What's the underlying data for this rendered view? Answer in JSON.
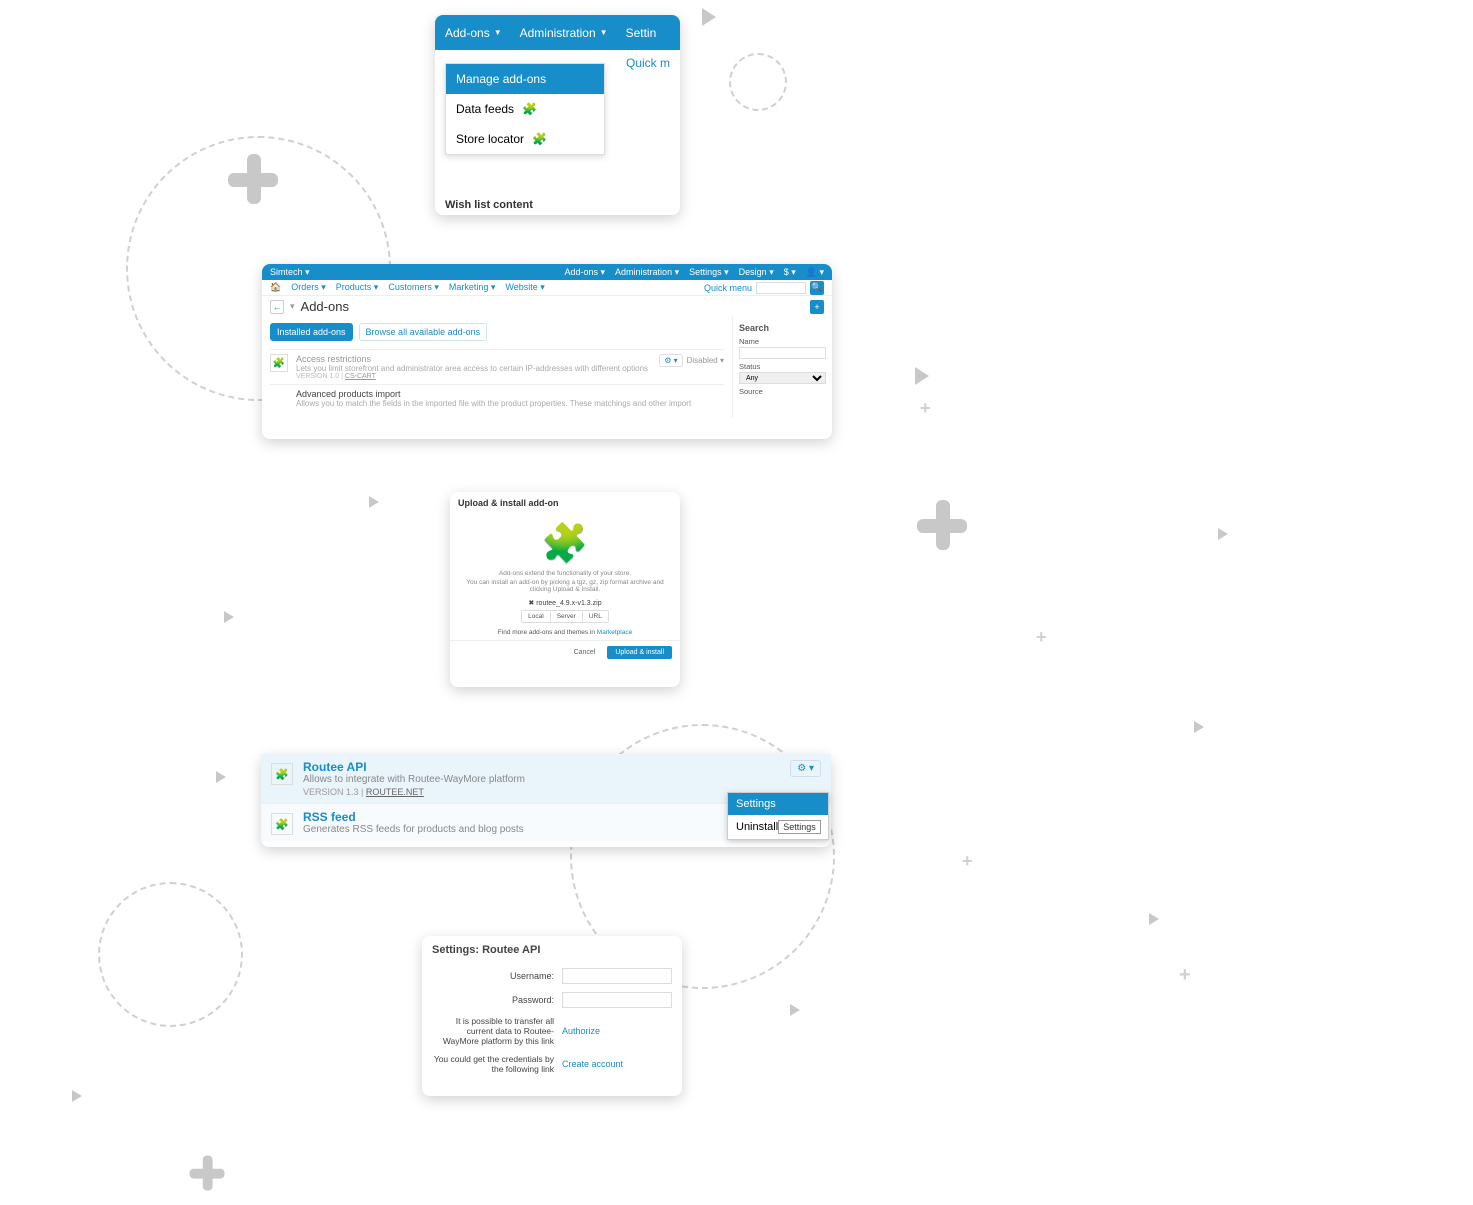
{
  "card1": {
    "nav": {
      "addons": "Add-ons",
      "administration": "Administration",
      "settings": "Settin"
    },
    "quick": "Quick m",
    "menu": {
      "manage": "Manage add-ons",
      "feeds": "Data feeds",
      "locator": "Store locator"
    },
    "wish": "Wish list content"
  },
  "card2": {
    "top": {
      "store": "Simtech",
      "addons": "Add-ons",
      "administration": "Administration",
      "settings": "Settings",
      "design": "Design",
      "currency": "$"
    },
    "nav": {
      "orders": "Orders",
      "products": "Products",
      "customers": "Customers",
      "marketing": "Marketing",
      "website": "Website",
      "quick": "Quick menu"
    },
    "title": "Add-ons",
    "tabs": {
      "installed": "Installed add-ons",
      "browse": "Browse all available add-ons"
    },
    "addon1": {
      "name": "Access restrictions",
      "desc": "Lets you limit storefront and administrator area access to certain IP-addresses with different options",
      "ver": "VERSION 1.0",
      "by": "CS-CART",
      "status": "Disabled"
    },
    "addon2": {
      "name": "Advanced products import",
      "desc": "Allows you to match the fields in the imported file with the product properties. These matchings and other import"
    },
    "side": {
      "search": "Search",
      "name": "Name",
      "status": "Status",
      "any": "Any",
      "source": "Source"
    }
  },
  "card3": {
    "title": "Upload & install add-on",
    "line1": "Add-ons extend the functionality of your store.",
    "line2": "You can install an add-on by picking a tgz, gz, zip format archive and clicking Upload & Install.",
    "file": "routee_4.9.x-v1.3.zip",
    "seg": {
      "local": "Local",
      "server": "Server",
      "url": "URL"
    },
    "mkt_pre": "Find more add-ons and themes in ",
    "mkt_link": "Marketplace",
    "cancel": "Cancel",
    "upload": "Upload & install"
  },
  "card4": {
    "r1": {
      "name": "Routee API",
      "desc": "Allows to integrate with Routee-WayMore platform",
      "ver": "VERSION 1.3",
      "by": "ROUTEE.NET"
    },
    "r2": {
      "name": "RSS feed",
      "desc": "Generates RSS feeds for products and blog posts"
    },
    "dd": {
      "settings": "Settings",
      "uninstall": "Uninstall",
      "tooltip": "Settings"
    }
  },
  "card5": {
    "title": "Settings: Routee API",
    "username": "Username:",
    "password": "Password:",
    "transfer": "It is possible to transfer all current data to Routee-WayMore platform by this link",
    "authorize": "Authorize",
    "cred": "You could get the credentials by the following link",
    "create": "Create account"
  }
}
